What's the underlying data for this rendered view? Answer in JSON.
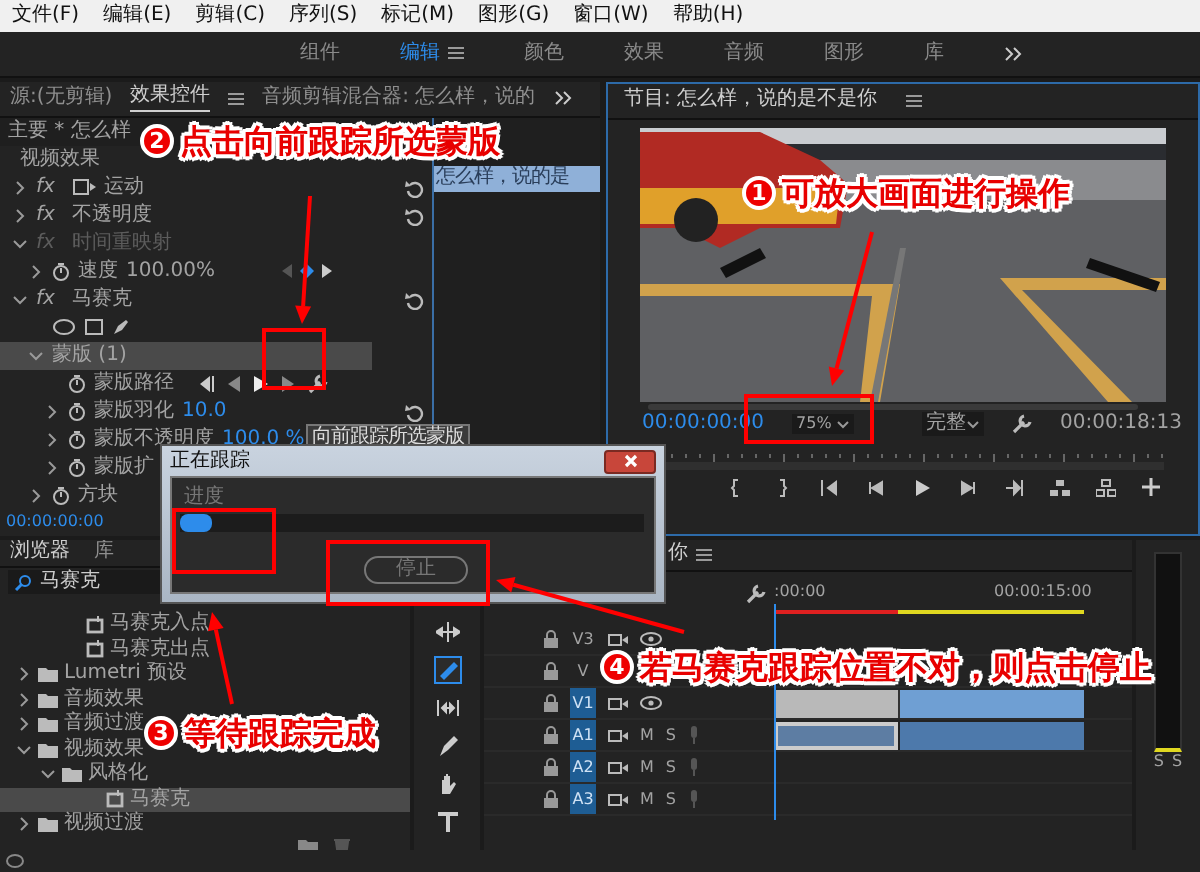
{
  "menu": [
    "文件(F)",
    "编辑(E)",
    "剪辑(C)",
    "序列(S)",
    "标记(M)",
    "图形(G)",
    "窗口(W)",
    "帮助(H)"
  ],
  "workspaces": [
    {
      "label": "组件",
      "selected": false
    },
    {
      "label": "编辑",
      "selected": true
    },
    {
      "label": "颜色",
      "selected": false
    },
    {
      "label": "效果",
      "selected": false
    },
    {
      "label": "音频",
      "selected": false
    },
    {
      "label": "图形",
      "selected": false
    },
    {
      "label": "库",
      "selected": false
    }
  ],
  "effect_controls": {
    "tabs": [
      {
        "label": "源:(无剪辑)",
        "selected": false
      },
      {
        "label": "效果控件",
        "selected": true
      },
      {
        "label": "音频剪辑混合器: 怎么样，说的",
        "selected": false
      }
    ],
    "clip_label": "主要 * 怎么样",
    "mini_clip": "怎么样，说的是",
    "section": "视频效果",
    "effects": [
      {
        "kind": "motion",
        "badge": "fx",
        "label": "运动",
        "expanded": false,
        "disabled": false
      },
      {
        "kind": "effect",
        "badge": "fx",
        "label": "不透明度",
        "expanded": false,
        "disabled": false
      },
      {
        "kind": "effect",
        "badge": "fx",
        "label": "时间重映射",
        "expanded": true,
        "disabled": true,
        "children": [
          {
            "kind": "speed",
            "label": "速度",
            "value": "100.00%",
            "expanded": false
          }
        ]
      },
      {
        "kind": "effect",
        "badge": "fx",
        "label": "马赛克",
        "expanded": true,
        "disabled": false,
        "children": [
          {
            "kind": "shapes"
          },
          {
            "kind": "mask",
            "label": "蒙版 (1)",
            "expanded": true,
            "children": [
              {
                "kind": "path",
                "label": "蒙版路径"
              },
              {
                "kind": "param",
                "label": "蒙版羽化",
                "value": "10.0",
                "expanded": false
              },
              {
                "kind": "param",
                "label": "蒙版不透明度",
                "value": "100.0 %",
                "expanded": false
              },
              {
                "kind": "param",
                "label": "蒙版扩",
                "expanded": false
              }
            ]
          },
          {
            "kind": "param",
            "label": "方块",
            "expanded": false
          }
        ]
      }
    ],
    "tooltip": "向前跟踪所选蒙版",
    "timecode": "00:00:00:00"
  },
  "program": {
    "title": "节目: 怎么样，说的是不是你",
    "timecode": "00:00:00:00",
    "zoom": "75%",
    "quality": "完整",
    "duration": "00:00:18:13"
  },
  "dialog": {
    "title": "正在跟踪",
    "progress_label": "进度",
    "level": 0.07,
    "button": "停止"
  },
  "project": {
    "tabs": [
      {
        "label": "浏览器",
        "selected": true
      },
      {
        "label": "库",
        "selected": false
      }
    ],
    "search": "马赛克",
    "tree": [
      {
        "kind": "preset",
        "label": "马赛克入点",
        "selected": false
      },
      {
        "kind": "preset",
        "label": "马赛克出点",
        "selected": false
      },
      {
        "kind": "folder",
        "label": "Lumetri 预设",
        "expanded": false,
        "selected": false
      },
      {
        "kind": "folder",
        "label": "音频效果",
        "expanded": false,
        "selected": false
      },
      {
        "kind": "folder",
        "label": "音频过渡",
        "expanded": false,
        "selected": false
      },
      {
        "kind": "folder",
        "label": "视频效果",
        "expanded": true,
        "selected": false,
        "children": [
          {
            "kind": "folder",
            "label": "风格化",
            "expanded": true,
            "selected": false,
            "children": [
              {
                "kind": "effect",
                "label": "马赛克",
                "selected": true
              }
            ]
          }
        ]
      },
      {
        "kind": "folder",
        "label": "视频过渡",
        "expanded": false,
        "selected": false
      }
    ]
  },
  "tools": [
    {
      "kind": "track-select",
      "selected": false
    },
    {
      "kind": "razor",
      "selected": true
    },
    {
      "kind": "slip",
      "selected": false
    },
    {
      "kind": "pen",
      "selected": false
    },
    {
      "kind": "hand",
      "selected": false
    },
    {
      "kind": "type",
      "selected": false
    }
  ],
  "timeline": {
    "title": "你",
    "ruler": [
      ":00:00",
      "00:00:15:00"
    ],
    "tracks": [
      {
        "kind": "video",
        "label": "V3",
        "targeted": false
      },
      {
        "kind": "covered",
        "label": "V",
        "targeted": false
      },
      {
        "kind": "video",
        "label": "V1",
        "targeted": true
      },
      {
        "kind": "audio",
        "label": "A1",
        "targeted": true,
        "mute": "M",
        "solo": "S"
      },
      {
        "kind": "audio",
        "label": "A2",
        "targeted": true,
        "mute": "M",
        "solo": "S"
      },
      {
        "kind": "audio",
        "label": "A3",
        "targeted": true,
        "mute": "M",
        "solo": "S"
      }
    ]
  },
  "meter": {
    "labels": [
      "S",
      "S"
    ]
  },
  "annotations": [
    {
      "number": "1",
      "text": "可放大画面进行操作"
    },
    {
      "number": "2",
      "text": "点击向前跟踪所选蒙版"
    },
    {
      "number": "3",
      "text": "等待跟踪完成"
    },
    {
      "number": "4",
      "text": "若马赛克跟踪位置不对，则点击停止"
    }
  ]
}
